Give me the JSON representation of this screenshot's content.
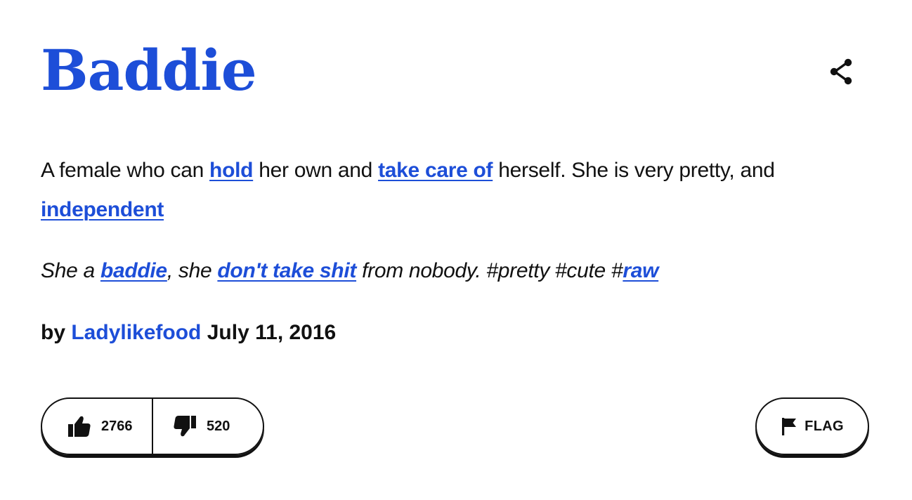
{
  "colors": {
    "link": "#1d4ed8",
    "text": "#111111",
    "border": "#111111"
  },
  "entry": {
    "word": "Baddie",
    "definition": {
      "t1": "A female who can ",
      "l1": "hold",
      "t2": " her own and ",
      "l2": "take care of",
      "t3": " herself. She is very pretty, and ",
      "l3": "independent"
    },
    "example": {
      "t1": "She a ",
      "l1": "baddie",
      "t2": ", she ",
      "l2": "don't take shit",
      "t3": " from nobody. #pretty #cute #",
      "l3": "raw"
    },
    "contributor": {
      "prefix": "by",
      "author": "Ladylikefood",
      "date": "July 11, 2016"
    }
  },
  "votes": {
    "up_icon": "thumbs-up-icon",
    "up_count": "2766",
    "down_icon": "thumbs-down-icon",
    "down_count": "520"
  },
  "actions": {
    "share_icon": "share-icon",
    "flag_icon": "flag-icon",
    "flag_label": "FLAG"
  }
}
